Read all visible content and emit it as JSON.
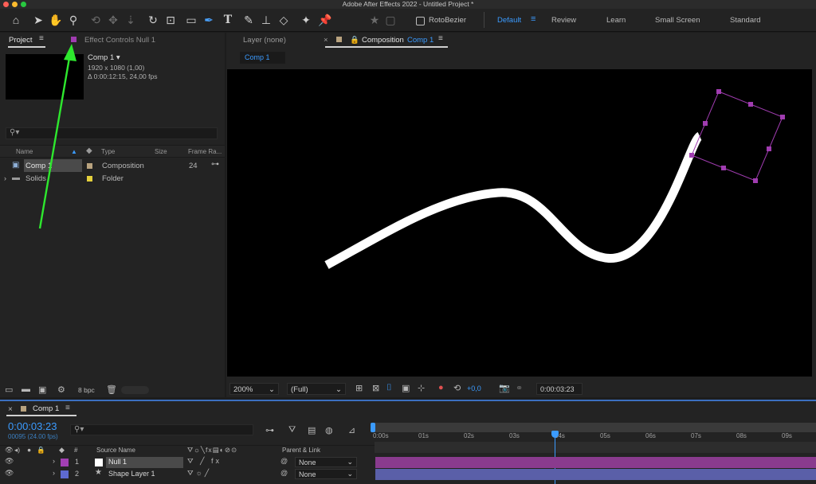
{
  "app": {
    "title": "Adobe After Effects 2022 - Untitled Project *"
  },
  "toolbar": {
    "rotobezier_label": "RotoBezier",
    "workspaces": [
      "Default",
      "Review",
      "Learn",
      "Small Screen",
      "Standard"
    ],
    "active_workspace": "Default"
  },
  "project": {
    "tab_label": "Project",
    "effect_controls_label": "Effect Controls Null 1",
    "comp_name": "Comp 1 ▾",
    "comp_size": "1920 x 1080 (1,00)",
    "comp_duration": "Δ 0:00:12:15, 24,00 fps",
    "search_placeholder": "",
    "columns": {
      "name": "Name",
      "type": "Type",
      "size": "Size",
      "frame_rate": "Frame Ra..."
    },
    "items": [
      {
        "name": "Comp 1",
        "type": "Composition",
        "size": "",
        "frame_rate": "24",
        "color": "#b9a37f"
      },
      {
        "name": "Solids",
        "type": "Folder",
        "size": "",
        "frame_rate": "",
        "color": "#e4d03c"
      }
    ],
    "bpc": "8 bpc"
  },
  "composition": {
    "layer_tab": "Layer (none)",
    "comp_tab_prefix": "Composition",
    "comp_tab_name": "Comp 1",
    "breadcrumb": "Comp 1",
    "zoom": "200%",
    "resolution": "(Full)",
    "exposure": "+0,0",
    "timecode": "0:00:03:23"
  },
  "timeline": {
    "tab_label": "Comp 1",
    "current_time": "0:00:03:23",
    "frame_info": "00095 (24.00 fps)",
    "columns": {
      "num": "#",
      "source_name": "Source Name",
      "parent_link": "Parent & Link"
    },
    "ticks": [
      "0:00s",
      "01s",
      "02s",
      "03s",
      "04s",
      "05s",
      "06s",
      "07s",
      "08s",
      "09s"
    ],
    "layers": [
      {
        "num": "1",
        "name": "Null 1",
        "parent": "None",
        "label_color": "#a23fb2",
        "bar_color": "#8a3b8e"
      },
      {
        "num": "2",
        "name": "Shape Layer 1",
        "parent": "None",
        "label_color": "#5e6ad0",
        "bar_color": "#5a5fa8"
      }
    ]
  },
  "colors": {
    "accent": "#3b9bff",
    "null_handles": "#a03cb0",
    "annotation_arrow": "#2ee82e"
  }
}
